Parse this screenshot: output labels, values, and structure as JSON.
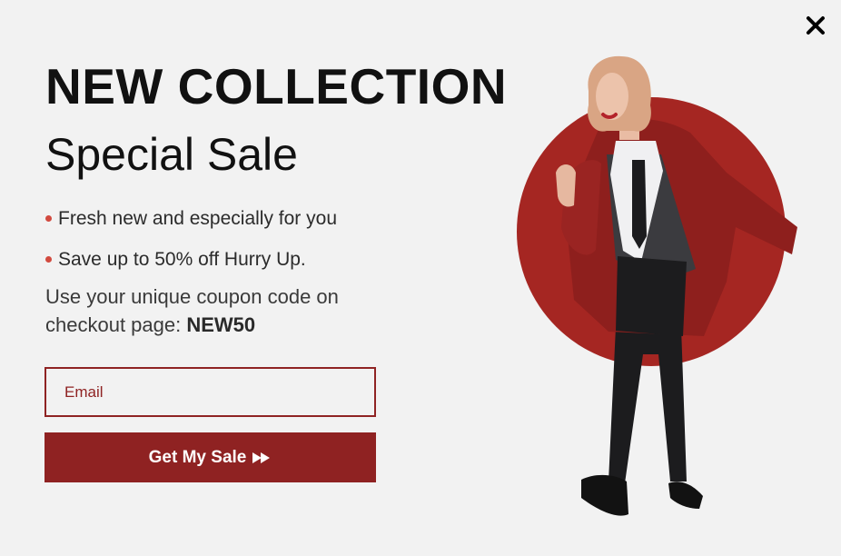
{
  "popup": {
    "headline": "NEW COLLECTION",
    "subheadline": "Special Sale",
    "bullets": [
      "Fresh new and especially for you",
      "Save up to 50% off Hurry Up."
    ],
    "coupon_text": "Use your unique coupon code on checkout page: ",
    "coupon_code": "NEW50",
    "email_placeholder": "Email",
    "cta_label": "Get My Sale",
    "close_icon": "close-icon",
    "cta_icon": "fast-forward-icon"
  },
  "colors": {
    "background": "#f2f2f2",
    "accent": "#8f2222",
    "bullet_dot": "#d24a3f",
    "circle": "#a52622"
  }
}
